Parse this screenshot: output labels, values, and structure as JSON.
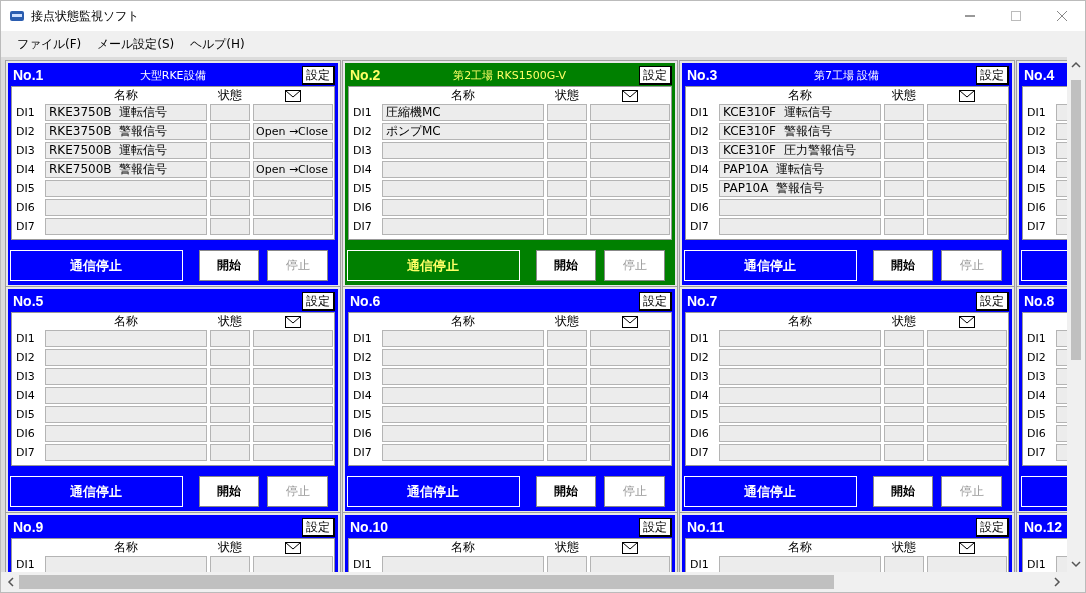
{
  "window": {
    "title": "接点状態監視ソフト"
  },
  "menu": [
    "ファイル(F)",
    "メール設定(S)",
    "ヘルプ(H)"
  ],
  "panels": [
    {
      "number": "No.1",
      "title": "大型RKE設備",
      "color": "#0000ff",
      "settings": "設定",
      "columns": [
        "名称",
        "状態"
      ],
      "rows": [
        {
          "label": "DI1",
          "name": "RKE3750B  運転信号"
        },
        {
          "label": "DI2",
          "name": "RKE3750B  警報信号",
          "mail": "Open →Close"
        },
        {
          "label": "DI3",
          "name": "RKE7500B  運転信号"
        },
        {
          "label": "DI4",
          "name": "RKE7500B  警報信号",
          "mail": "Open →Close"
        },
        {
          "label": "DI5"
        },
        {
          "label": "DI6"
        },
        {
          "label": "DI7"
        }
      ],
      "status": "通信停止",
      "start": {
        "label": "開始",
        "disabled": false
      },
      "stop": {
        "label": "停止",
        "disabled": true
      }
    },
    {
      "number": "No.2",
      "title": "第2工場  RKS1500G-V",
      "color": "#008000",
      "settings": "設定",
      "columns": [
        "名称",
        "状態"
      ],
      "rows": [
        {
          "label": "DI1",
          "name": "圧縮機MC"
        },
        {
          "label": "DI2",
          "name": "ポンプMC"
        },
        {
          "label": "DI3"
        },
        {
          "label": "DI4"
        },
        {
          "label": "DI5"
        },
        {
          "label": "DI6"
        },
        {
          "label": "DI7"
        }
      ],
      "status": "通信停止",
      "start": {
        "label": "開始",
        "disabled": false
      },
      "stop": {
        "label": "停止",
        "disabled": true
      }
    },
    {
      "number": "No.3",
      "title": "第7工場  設備",
      "color": "#0000ff",
      "settings": "設定",
      "columns": [
        "名称",
        "状態"
      ],
      "rows": [
        {
          "label": "DI1",
          "name": "KCE310F  運転信号"
        },
        {
          "label": "DI2",
          "name": "KCE310F  警報信号"
        },
        {
          "label": "DI3",
          "name": "KCE310F  圧力警報信号"
        },
        {
          "label": "DI4",
          "name": "PAP10A  運転信号"
        },
        {
          "label": "DI5",
          "name": "PAP10A  警報信号"
        },
        {
          "label": "DI6"
        },
        {
          "label": "DI7"
        }
      ],
      "status": "通信停止",
      "start": {
        "label": "開始",
        "disabled": false
      },
      "stop": {
        "label": "停止",
        "disabled": true
      }
    },
    {
      "number": "No.4",
      "color": "#0000ff",
      "rows": [
        {
          "label": "DI1"
        },
        {
          "label": "DI2"
        },
        {
          "label": "DI3"
        },
        {
          "label": "DI4"
        },
        {
          "label": "DI5"
        },
        {
          "label": "DI6"
        },
        {
          "label": "DI7"
        }
      ]
    },
    {
      "number": "No.5",
      "color": "#0000ff",
      "settings": "設定",
      "columns": [
        "名称",
        "状態"
      ],
      "rows": [
        {
          "label": "DI1"
        },
        {
          "label": "DI2"
        },
        {
          "label": "DI3"
        },
        {
          "label": "DI4"
        },
        {
          "label": "DI5"
        },
        {
          "label": "DI6"
        },
        {
          "label": "DI7"
        }
      ],
      "status": "通信停止",
      "start": {
        "label": "開始",
        "disabled": false
      },
      "stop": {
        "label": "停止",
        "disabled": true
      }
    },
    {
      "number": "No.6",
      "color": "#0000ff",
      "settings": "設定",
      "columns": [
        "名称",
        "状態"
      ],
      "rows": [
        {
          "label": "DI1"
        },
        {
          "label": "DI2"
        },
        {
          "label": "DI3"
        },
        {
          "label": "DI4"
        },
        {
          "label": "DI5"
        },
        {
          "label": "DI6"
        },
        {
          "label": "DI7"
        }
      ],
      "status": "通信停止",
      "start": {
        "label": "開始",
        "disabled": false
      },
      "stop": {
        "label": "停止",
        "disabled": true
      }
    },
    {
      "number": "No.7",
      "color": "#0000ff",
      "settings": "設定",
      "columns": [
        "名称",
        "状態"
      ],
      "rows": [
        {
          "label": "DI1"
        },
        {
          "label": "DI2"
        },
        {
          "label": "DI3"
        },
        {
          "label": "DI4"
        },
        {
          "label": "DI5"
        },
        {
          "label": "DI6"
        },
        {
          "label": "DI7"
        }
      ],
      "status": "通信停止",
      "start": {
        "label": "開始",
        "disabled": false
      },
      "stop": {
        "label": "停止",
        "disabled": true
      }
    },
    {
      "number": "No.8",
      "color": "#0000ff",
      "rows": [
        {
          "label": "DI1"
        },
        {
          "label": "DI2"
        },
        {
          "label": "DI3"
        },
        {
          "label": "DI4"
        },
        {
          "label": "DI5"
        },
        {
          "label": "DI6"
        },
        {
          "label": "DI7"
        }
      ]
    },
    {
      "number": "No.9",
      "color": "#0000ff",
      "settings": "設定",
      "columns": [
        "名称",
        "状態"
      ],
      "rows": [
        {
          "label": "DI1"
        }
      ]
    },
    {
      "number": "No.10",
      "color": "#0000ff",
      "settings": "設定",
      "columns": [
        "名称",
        "状態"
      ],
      "rows": [
        {
          "label": "DI1"
        }
      ]
    },
    {
      "number": "No.11",
      "color": "#0000ff",
      "settings": "設定",
      "columns": [
        "名称",
        "状態"
      ],
      "rows": [
        {
          "label": "DI1"
        }
      ]
    },
    {
      "number": "No.12",
      "color": "#0000ff",
      "rows": [
        {
          "label": "DI1"
        }
      ]
    }
  ]
}
